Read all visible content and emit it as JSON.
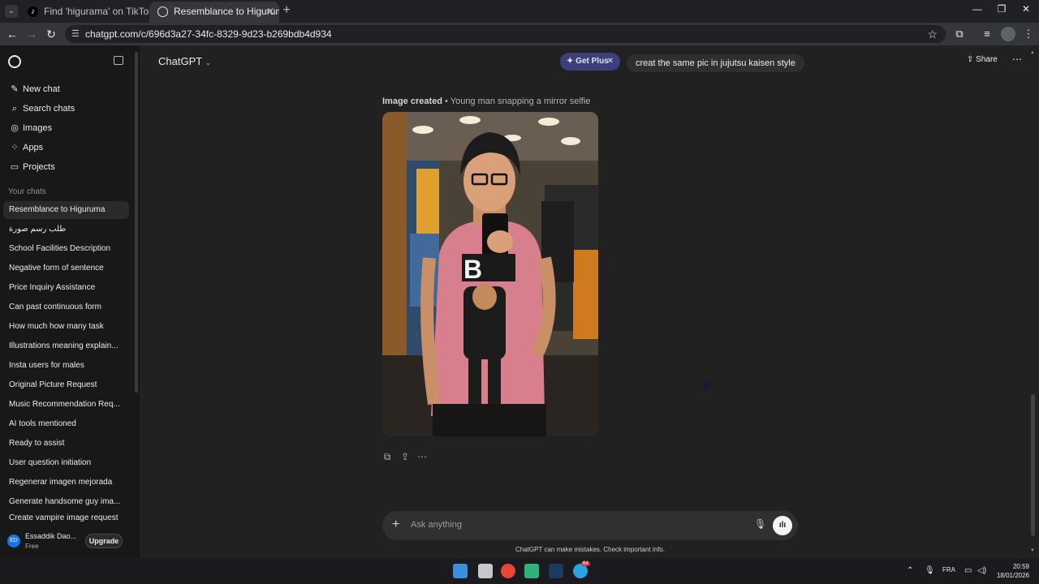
{
  "browser": {
    "tabs": [
      {
        "title": "Find 'higurama' on TikTok | TikT",
        "active": false
      },
      {
        "title": "Resemblance to Higuruma",
        "active": true
      }
    ],
    "url": "chatgpt.com/c/696d3a27-34fc-8329-9d23-b269bdb4d934"
  },
  "sidebar": {
    "nav": [
      {
        "label": "New chat",
        "icon": "edit-icon"
      },
      {
        "label": "Search chats",
        "icon": "search-icon"
      },
      {
        "label": "Images",
        "icon": "images-icon"
      },
      {
        "label": "Apps",
        "icon": "apps-icon"
      },
      {
        "label": "Projects",
        "icon": "folder-icon"
      }
    ],
    "section_label": "Your chats",
    "chats": [
      "Resemblance to Higuruma",
      "طلب رسم صورة",
      "School Facilities Description",
      "Negative form of sentence",
      "Price Inquiry Assistance",
      "Can past continuous form",
      "How much how many task",
      "Illustrations meaning explain...",
      "Insta users for males",
      "Original Picture Request",
      "Music Recommendation Req...",
      "AI tools mentioned",
      "Ready to assist",
      "User question initiation",
      "Regenerar imagen mejorada",
      "Generate handsome guy ima...",
      "Create vampire image request"
    ],
    "account": {
      "initials": "ED",
      "name": "Essaddik Dao...",
      "plan": "Free",
      "upgrade_label": "Upgrade"
    }
  },
  "header": {
    "model_label": "ChatGPT",
    "get_plus_label": "Get Plus",
    "share_label": "Share"
  },
  "conversation": {
    "user_message": "creat the same pic in jujutsu kaisen style",
    "image_caption_bold": "Image created",
    "image_caption_rest": " • Young man snapping a mirror selfie"
  },
  "composer": {
    "placeholder": "Ask anything",
    "disclaimer": "ChatGPT can make mistakes. Check important info."
  },
  "taskbar": {
    "language": "FRA",
    "time": "20:59",
    "date": "18/01/2026",
    "badge": "64"
  },
  "colors": {
    "accent_plus": "#3c3f7a",
    "background": "#212121",
    "sidebar": "#181818"
  }
}
